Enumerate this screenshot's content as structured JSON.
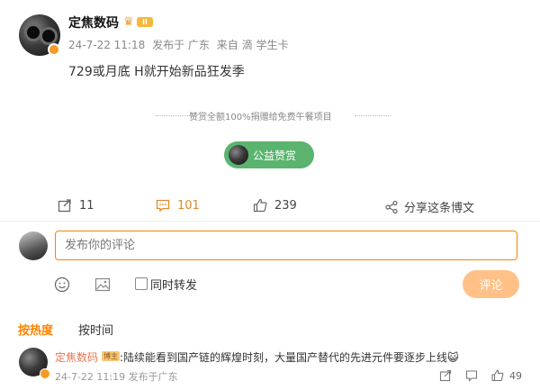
{
  "post": {
    "username": "定焦数码",
    "level_badge": "II",
    "time": "24-7-22 11:18",
    "location": "发布于 广东",
    "source_prefix": "来自",
    "source": "滴 学生卡",
    "content": "729或月底 H就开始新品狂发季"
  },
  "reward": {
    "text": "赞赏全额100%捐赠给免费午餐项目",
    "button_label": "公益赞赏"
  },
  "actions": {
    "repost_count": "11",
    "comment_count": "101",
    "like_count": "239",
    "share_label": "分享这条博文"
  },
  "composer": {
    "placeholder": "发布你的评论",
    "repost_label": "同时转发",
    "submit_label": "评论"
  },
  "sort": {
    "hot": "按热度",
    "time": "按时间"
  },
  "comment": {
    "username": "定焦数码",
    "author_tag": "博主",
    "text": ":陆续能看到国产链的辉煌时刻，大量国产替代的先进元件要逐步上线😺",
    "time_location": "24-7-22 11:19 发布于广东",
    "likes": "49"
  },
  "colors": {
    "accent": "#ff8200",
    "reward_green": "#5ab46e",
    "submit_disabled": "#ffc187"
  }
}
